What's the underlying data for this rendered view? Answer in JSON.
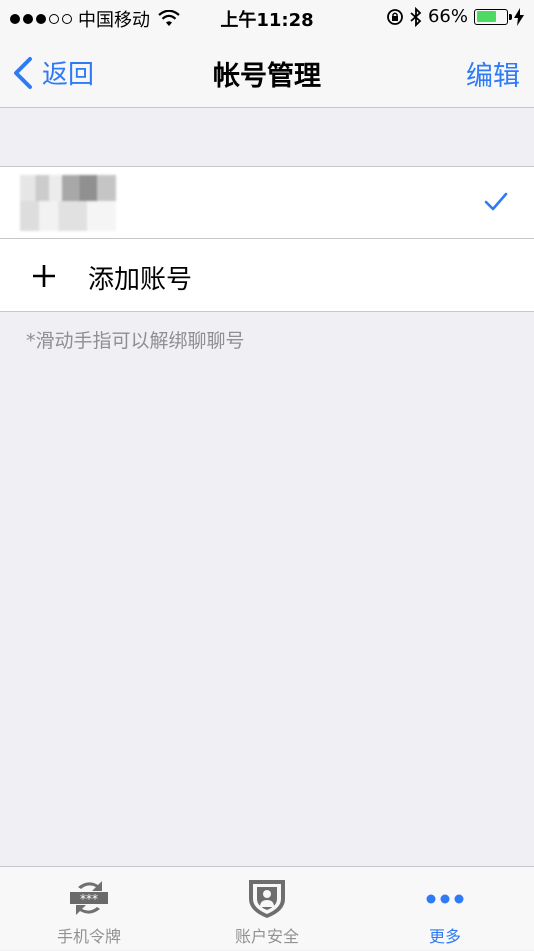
{
  "status_bar": {
    "carrier": "中国移动",
    "time": "上午11:28",
    "battery": "66%",
    "battery_level": 0.66
  },
  "nav": {
    "back_label": "返回",
    "title": "帐号管理",
    "edit_label": "编辑"
  },
  "list": {
    "add_account_label": "添加账号"
  },
  "footnote": "*滑动手指可以解绑聊聊号",
  "tabs": [
    {
      "label": "手机令牌",
      "icon": "token-icon",
      "active": false
    },
    {
      "label": "账户安全",
      "icon": "shield-user-icon",
      "active": false
    },
    {
      "label": "更多",
      "icon": "more-dots-icon",
      "active": true
    }
  ],
  "colors": {
    "accent": "#2f7bf6",
    "background": "#efeff4",
    "battery_green": "#4cd964"
  }
}
